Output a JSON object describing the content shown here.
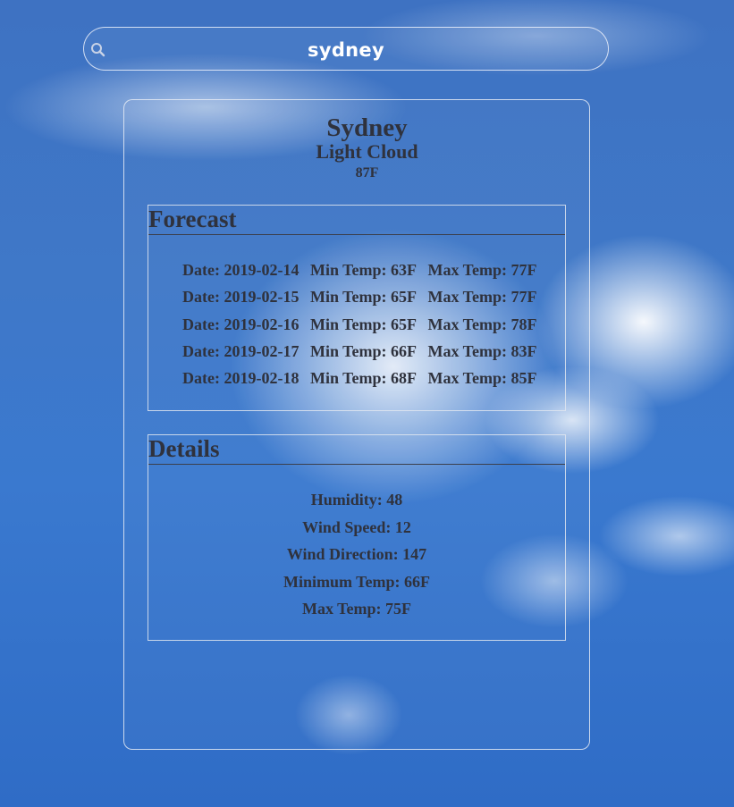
{
  "search": {
    "value": "sydney",
    "icon": "search-icon"
  },
  "current": {
    "city": "Sydney",
    "condition": "Light Cloud",
    "temp": "87F"
  },
  "forecast": {
    "title": "Forecast",
    "rows": [
      {
        "date": "Date: 2019-02-14",
        "min": "Min Temp: 63F",
        "max": "Max Temp: 77F"
      },
      {
        "date": "Date: 2019-02-15",
        "min": "Min Temp: 65F",
        "max": "Max Temp: 77F"
      },
      {
        "date": "Date: 2019-02-16",
        "min": "Min Temp: 65F",
        "max": "Max Temp: 78F"
      },
      {
        "date": "Date: 2019-02-17",
        "min": "Min Temp: 66F",
        "max": "Max Temp: 83F"
      },
      {
        "date": "Date: 2019-02-18",
        "min": "Min Temp: 68F",
        "max": "Max Temp: 85F"
      }
    ]
  },
  "details": {
    "title": "Details",
    "humidity": "Humidity: 48",
    "wind_speed": "Wind Speed: 12",
    "wind_direction": "Wind Direction: 147",
    "min_temp": "Minimum Temp: 66F",
    "max_temp": "Max Temp: 75F"
  },
  "colors": {
    "sky": "#3e72c2",
    "text": "#2f323d",
    "border": "#e6ebf5"
  }
}
